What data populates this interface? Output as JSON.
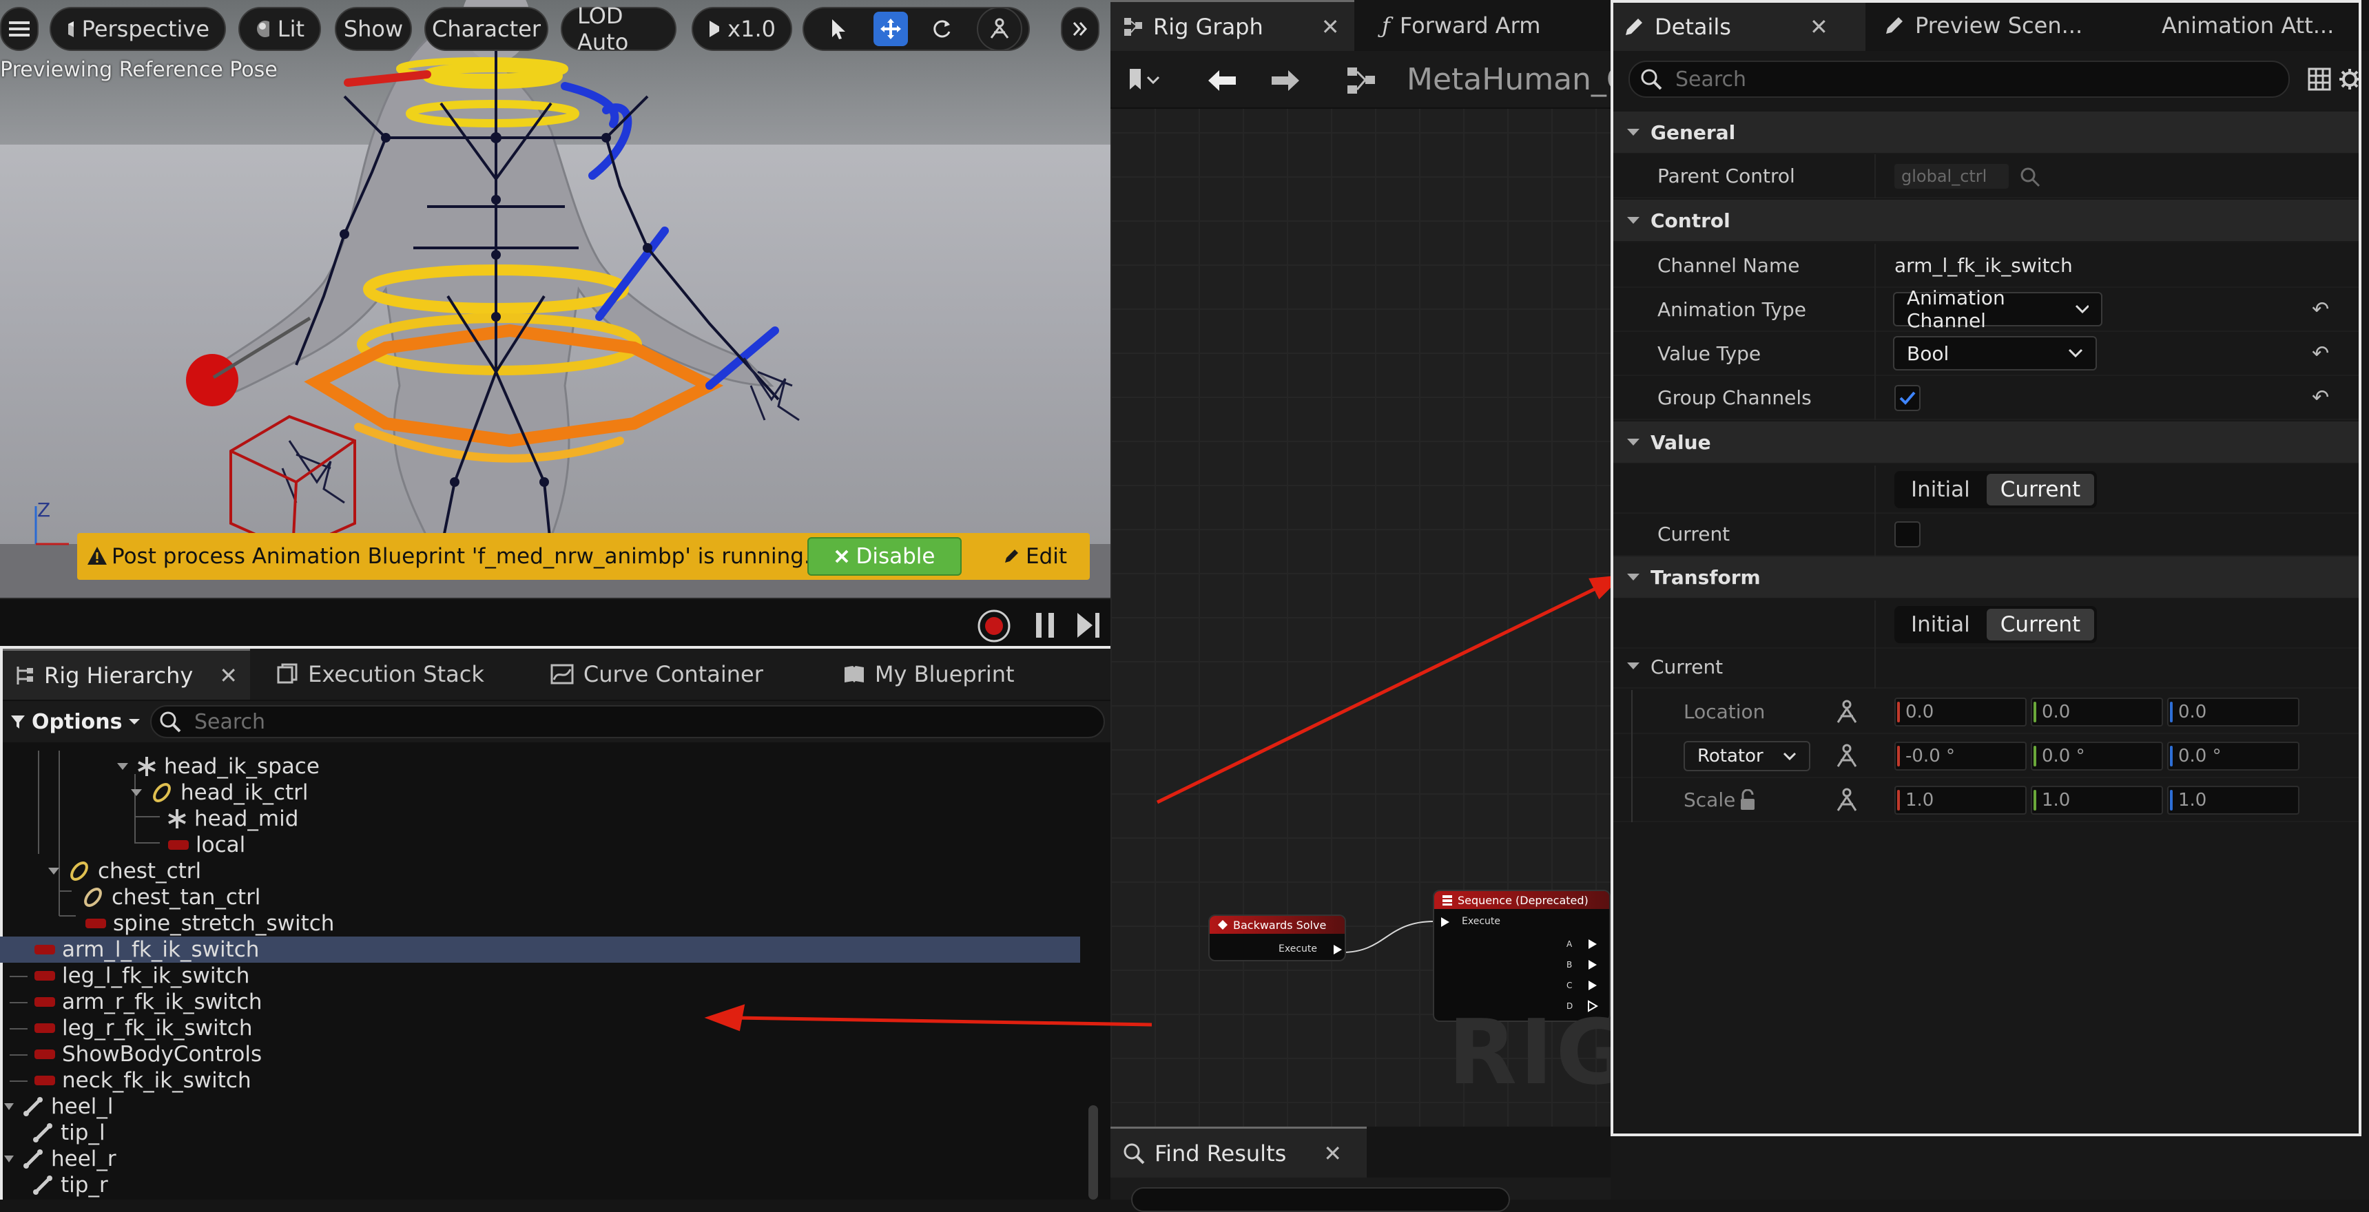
{
  "viewport": {
    "toolbar": {
      "perspective": "Perspective",
      "lit": "Lit",
      "show": "Show",
      "character": "Character",
      "lod": "LOD Auto",
      "speed": "x1.0"
    },
    "caption": "Previewing Reference Pose",
    "axis_label": "Z",
    "notification": {
      "message": "Post process Animation Blueprint 'f_med_nrw_animbp' is running.",
      "disable": "Disable",
      "edit": "Edit"
    }
  },
  "hierarchy": {
    "tabs": [
      "Rig Hierarchy",
      "Execution Stack",
      "Curve Container",
      "My Blueprint"
    ],
    "options": "Options",
    "search_placeholder": "Search",
    "nodes": [
      "head_ik_space",
      "head_ik_ctrl",
      "head_mid",
      "local",
      "chest_ctrl",
      "chest_tan_ctrl",
      "spine_stretch_switch",
      "arm_l_fk_ik_switch",
      "leg_l_fk_ik_switch",
      "arm_r_fk_ik_switch",
      "leg_r_fk_ik_switch",
      "ShowBodyControls",
      "neck_fk_ik_switch",
      "heel_l",
      "tip_l",
      "heel_r",
      "tip_r"
    ],
    "selected": "arm_l_fk_ik_switch"
  },
  "graph": {
    "tabs": [
      "Rig Graph",
      "Forward Arm"
    ],
    "title": "MetaHuman_C",
    "node_backwards": {
      "title": "Backwards Solve",
      "pin": "Execute"
    },
    "node_sequence": {
      "title": "Sequence (Deprecated)",
      "pin": "Execute",
      "outputs": [
        "A",
        "B",
        "C",
        "D"
      ]
    },
    "watermark": "RIG",
    "find_results": "Find Results"
  },
  "details": {
    "tabs": [
      "Details",
      "Preview Scen...",
      "Animation Att..."
    ],
    "search_placeholder": "Search",
    "general": {
      "header": "General",
      "parent_control_label": "Parent Control",
      "parent_control_value": "global_ctrl"
    },
    "control": {
      "header": "Control",
      "channel_name_label": "Channel Name",
      "channel_name_value": "arm_l_fk_ik_switch",
      "animation_type_label": "Animation Type",
      "animation_type_value": "Animation Channel",
      "value_type_label": "Value Type",
      "value_type_value": "Bool",
      "group_channels_label": "Group Channels",
      "group_channels_checked": true
    },
    "value": {
      "header": "Value",
      "seg_initial": "Initial",
      "seg_current": "Current",
      "current_label": "Current",
      "current_checked": false
    },
    "transform": {
      "header": "Transform",
      "seg_initial": "Initial",
      "seg_current": "Current",
      "current_header": "Current",
      "location_label": "Location",
      "location": [
        "0.0",
        "0.0",
        "0.0"
      ],
      "rotator_label": "Rotator",
      "rotator": [
        "-0.0 °",
        "0.0 °",
        "0.0 °"
      ],
      "scale_label": "Scale",
      "scale": [
        "1.0",
        "1.0",
        "1.0"
      ]
    }
  },
  "colors": {
    "accent_blue": "#2e6fd6",
    "warning_yellow": "#e5ad17",
    "disable_green": "#5cb540",
    "selection": "#3b4763",
    "annotation_red": "#e02010"
  }
}
